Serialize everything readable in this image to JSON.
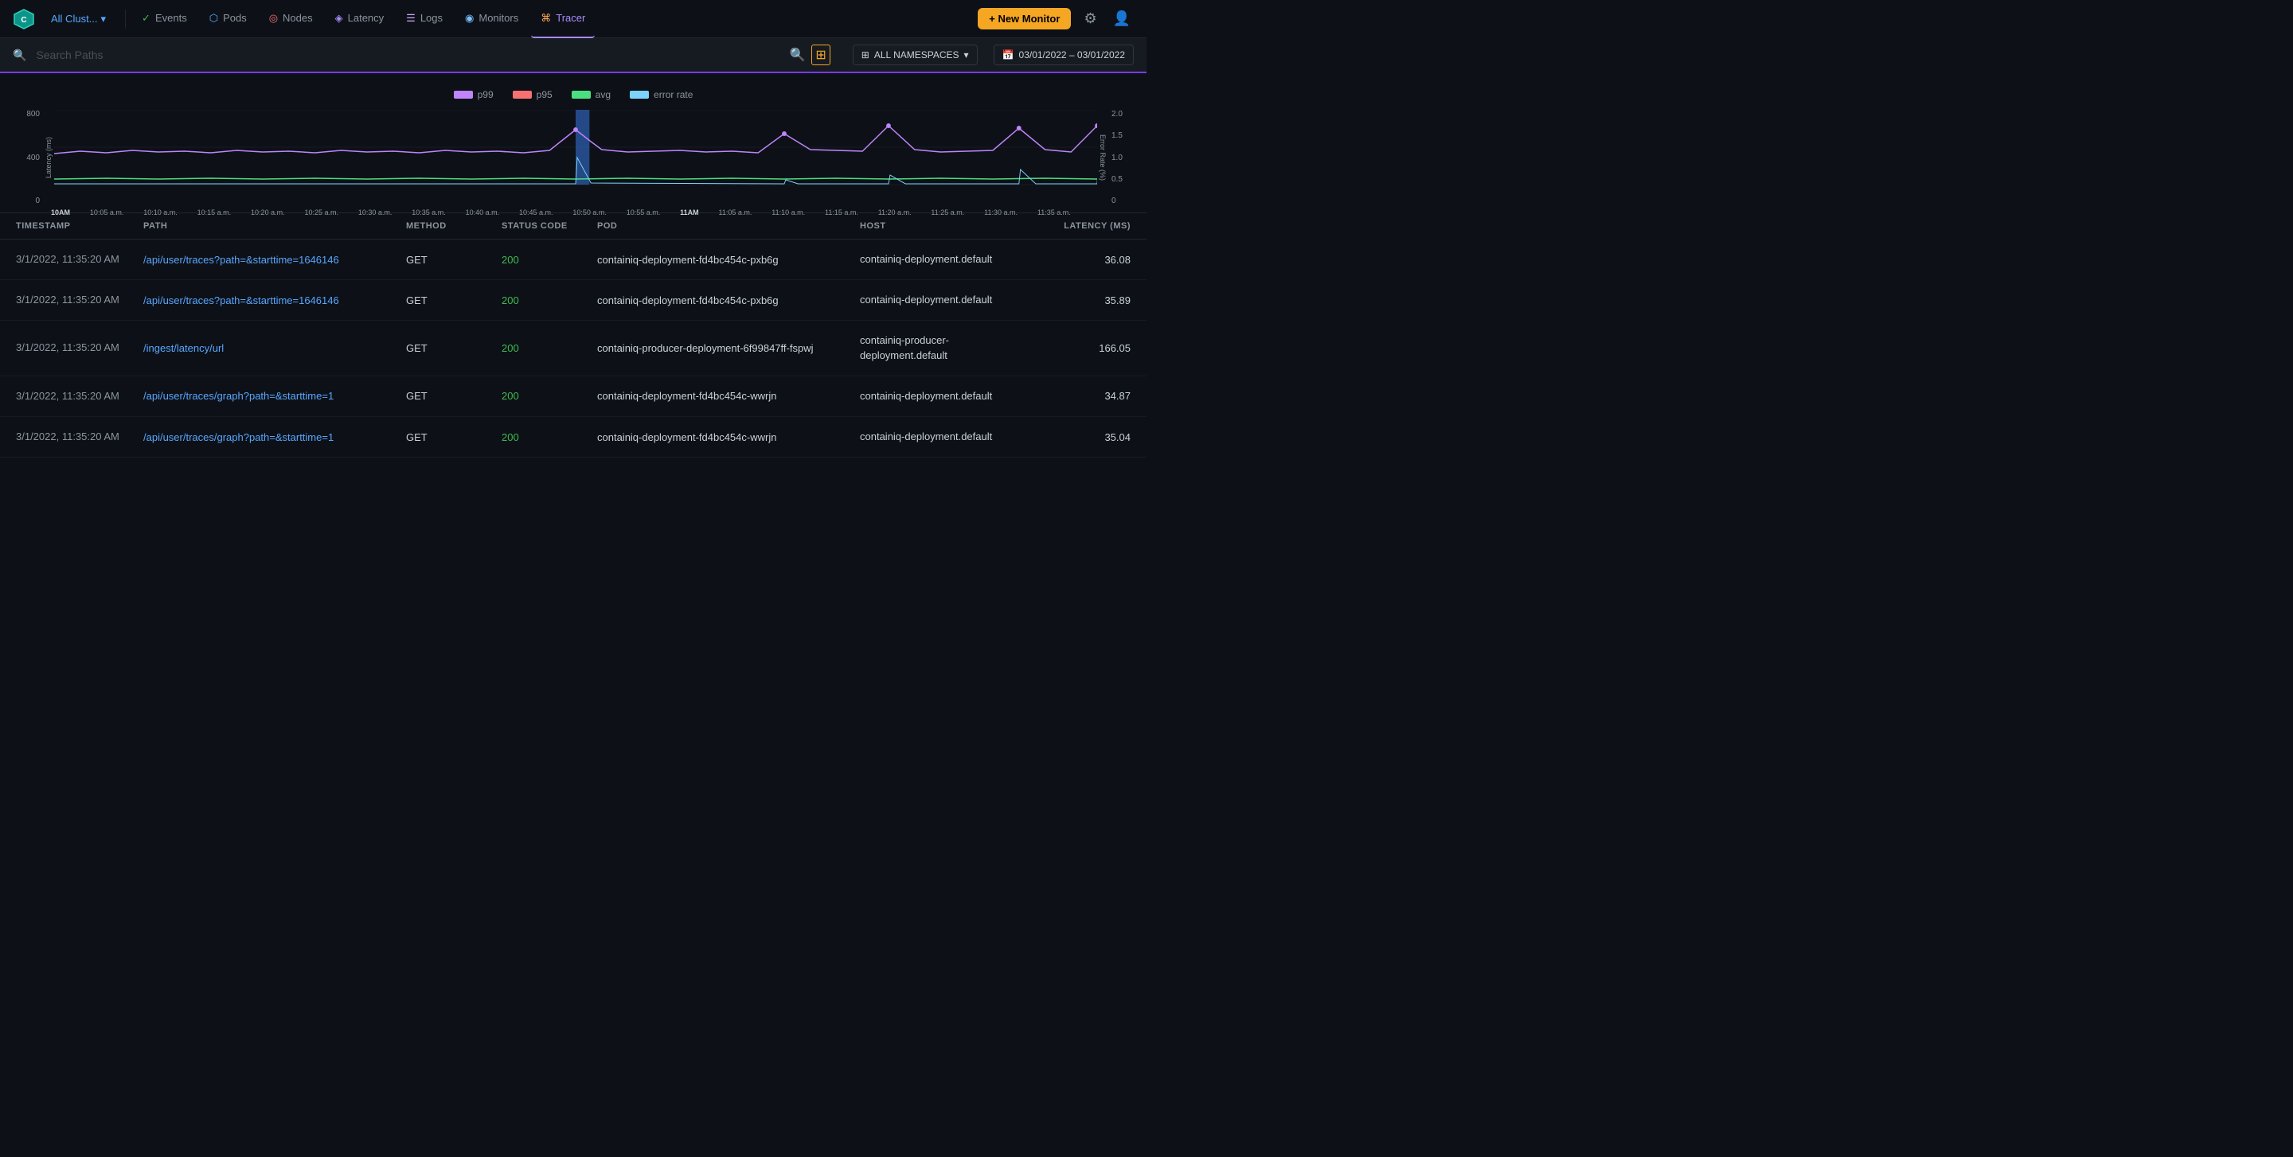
{
  "topnav": {
    "cluster_label": "All Clust...",
    "nav_items": [
      {
        "id": "events",
        "label": "Events",
        "icon": "✓",
        "active": false
      },
      {
        "id": "pods",
        "label": "Pods",
        "icon": "⬡",
        "active": false
      },
      {
        "id": "nodes",
        "label": "Nodes",
        "icon": "◎",
        "active": false
      },
      {
        "id": "latency",
        "label": "Latency",
        "icon": "◈",
        "active": false
      },
      {
        "id": "logs",
        "label": "Logs",
        "icon": "☰",
        "active": false
      },
      {
        "id": "monitors",
        "label": "Monitors",
        "icon": "◉",
        "active": false
      },
      {
        "id": "tracer",
        "label": "Tracer",
        "icon": "⌘",
        "active": true
      }
    ],
    "new_monitor_label": "+ New Monitor"
  },
  "searchbar": {
    "placeholder": "Search Paths",
    "namespace_label": "ALL NAMESPACES",
    "date_range": "03/01/2022  –  03/01/2022"
  },
  "chart": {
    "legend": [
      {
        "id": "p99",
        "label": "p99",
        "color": "#c084fc"
      },
      {
        "id": "p95",
        "label": "p95",
        "color": "#f87171"
      },
      {
        "id": "avg",
        "label": "avg",
        "color": "#4ade80"
      },
      {
        "id": "error_rate",
        "label": "error rate",
        "color": "#7dd3fc"
      }
    ],
    "y_label_left": "Latency (ms)",
    "y_label_right": "Error Rate (%)",
    "y_ticks_left": [
      "800",
      "400",
      "0"
    ],
    "y_ticks_right": [
      "2.0",
      "1.5",
      "1.0",
      "0.5",
      "0"
    ],
    "x_labels": [
      {
        "label": "10AM",
        "bold": true
      },
      {
        "label": "10:05 a.m."
      },
      {
        "label": "10:10 a.m."
      },
      {
        "label": "10:15 a.m."
      },
      {
        "label": "10:20 a.m."
      },
      {
        "label": "10:25 a.m."
      },
      {
        "label": "10:30 a.m."
      },
      {
        "label": "10:35 a.m."
      },
      {
        "label": "10:40 a.m."
      },
      {
        "label": "10:45 a.m."
      },
      {
        "label": "10:50 a.m."
      },
      {
        "label": "10:55 a.m."
      },
      {
        "label": "11AM",
        "bold": true
      },
      {
        "label": "11:05 a.m."
      },
      {
        "label": "11:10 a.m."
      },
      {
        "label": "11:15 a.m."
      },
      {
        "label": "11:20 a.m."
      },
      {
        "label": "11:25 a.m."
      },
      {
        "label": "11:30 a.m."
      },
      {
        "label": "11:35 a.m."
      }
    ]
  },
  "table": {
    "columns": [
      {
        "id": "timestamp",
        "label": "TIMESTAMP"
      },
      {
        "id": "path",
        "label": "PATH"
      },
      {
        "id": "method",
        "label": "METHOD"
      },
      {
        "id": "status_code",
        "label": "STATUS CODE"
      },
      {
        "id": "pod",
        "label": "POD"
      },
      {
        "id": "host",
        "label": "HOST"
      },
      {
        "id": "latency",
        "label": "LATENCY (MS)",
        "align": "right"
      }
    ],
    "rows": [
      {
        "timestamp": "3/1/2022, 11:35:20 AM",
        "path": "/api/user/traces?path=&starttime=1646146",
        "method": "GET",
        "status_code": "200",
        "pod": "containiq-deployment-fd4bc454c-pxb6g",
        "host": "containiq-deployment.default",
        "latency": "36.08"
      },
      {
        "timestamp": "3/1/2022, 11:35:20 AM",
        "path": "/api/user/traces?path=&starttime=1646146",
        "method": "GET",
        "status_code": "200",
        "pod": "containiq-deployment-fd4bc454c-pxb6g",
        "host": "containiq-deployment.default",
        "latency": "35.89"
      },
      {
        "timestamp": "3/1/2022, 11:35:20 AM",
        "path": "/ingest/latency/url",
        "method": "GET",
        "status_code": "200",
        "pod": "containiq-producer-deployment-6f99847ff-fspwj",
        "host": "containiq-producer-deployment.default",
        "latency": "166.05"
      },
      {
        "timestamp": "3/1/2022, 11:35:20 AM",
        "path": "/api/user/traces/graph?path=&starttime=1",
        "method": "GET",
        "status_code": "200",
        "pod": "containiq-deployment-fd4bc454c-wwrjn",
        "host": "containiq-deployment.default",
        "latency": "34.87"
      },
      {
        "timestamp": "3/1/2022, 11:35:20 AM",
        "path": "/api/user/traces/graph?path=&starttime=1",
        "method": "GET",
        "status_code": "200",
        "pod": "containiq-deployment-fd4bc454c-wwrjn",
        "host": "containiq-deployment.default",
        "latency": "35.04"
      }
    ]
  }
}
